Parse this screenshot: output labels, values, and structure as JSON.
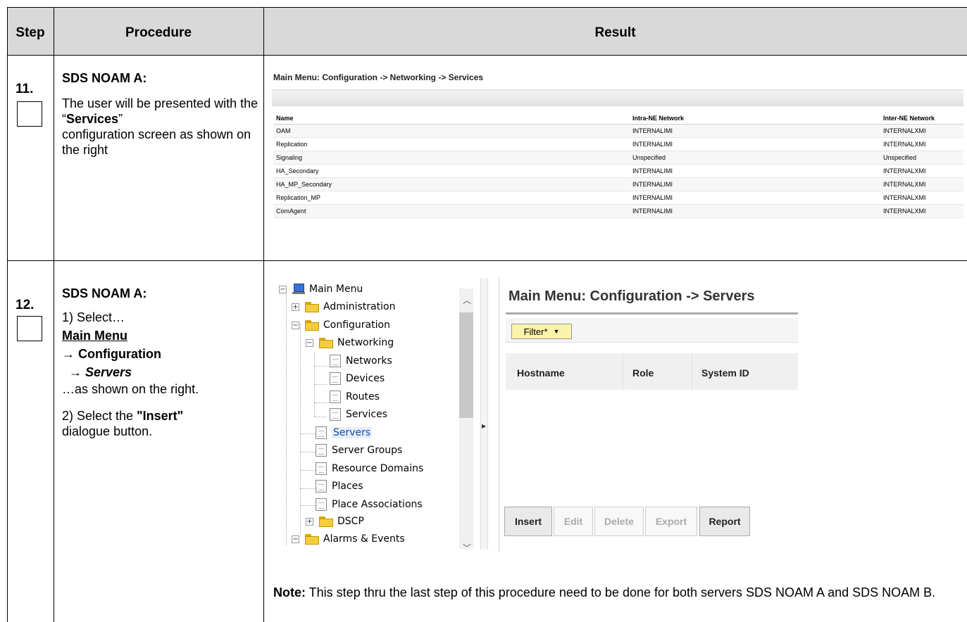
{
  "header": {
    "step": "Step",
    "procedure": "Procedure",
    "result": "Result"
  },
  "step11": {
    "number": "11.",
    "title": "SDS NOAM A:",
    "text1": "The user will be presented with the",
    "quote_open": "“",
    "services": "Services",
    "quote_close": "”",
    "text2": "configuration screen as shown on the right",
    "screen": {
      "title": "Main Menu: Configuration -> Networking -> Services",
      "columns": [
        "Name",
        "Intra-NE Network",
        "Inter-NE Network"
      ],
      "rows": [
        [
          "OAM",
          "INTERNALIMI",
          "INTERNALXMI"
        ],
        [
          "Replication",
          "INTERNALIMI",
          "INTERNALXMI"
        ],
        [
          "Signaling",
          "Unspecified",
          "Unspecified"
        ],
        [
          "HA_Secondary",
          "INTERNALIMI",
          "INTERNALXMI"
        ],
        [
          "HA_MP_Secondary",
          "INTERNALIMI",
          "INTERNALXMI"
        ],
        [
          "Replication_MP",
          "INTERNALIMI",
          "INTERNALXMI"
        ],
        [
          "ComAgent",
          "INTERNALIMI",
          "INTERNALXMI"
        ]
      ]
    }
  },
  "step12": {
    "number": "12.",
    "title": "SDS NOAM A:",
    "select": "1) Select…",
    "main_menu": "Main Menu",
    "arrow_configuration": "→ Configuration",
    "arrow_servers": "→ Servers",
    "as_shown": "…as shown on the right.",
    "select_the": "2) Select the ",
    "insert": "\"Insert\"",
    "dialogue": "dialogue button.",
    "tree": {
      "main_menu": "Main Menu",
      "administration": "Administration",
      "configuration": "Configuration",
      "networking": "Networking",
      "networks": "Networks",
      "devices": "Devices",
      "routes": "Routes",
      "services": "Services",
      "servers": "Servers",
      "server_groups": "Server Groups",
      "resource_domains": "Resource Domains",
      "places": "Places",
      "place_associations": "Place Associations",
      "dscp": "DSCP",
      "alarms_events": "Alarms & Events"
    },
    "screen": {
      "title": "Main Menu: Configuration -> Servers",
      "filter": "Filter*",
      "columns": [
        "Hostname",
        "Role",
        "System ID"
      ],
      "buttons": {
        "insert": "Insert",
        "edit": "Edit",
        "delete": "Delete",
        "export": "Export",
        "report": "Report"
      }
    },
    "note_label": "Note:",
    "note_text": " This step thru the last step of this procedure need to be done for both servers SDS NOAM A and SDS NOAM B."
  }
}
